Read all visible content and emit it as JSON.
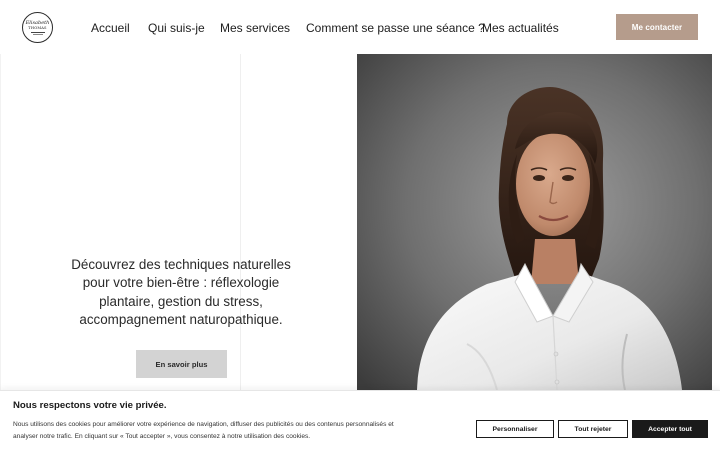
{
  "brand": {
    "logo_script": "Elisabeth",
    "logo_name": "THOMAS"
  },
  "nav": {
    "items": [
      {
        "label": "Accueil"
      },
      {
        "label": "Qui suis-je"
      },
      {
        "label": "Mes services"
      },
      {
        "label": "Comment se passe une séance ?"
      },
      {
        "label": "Mes actualités"
      }
    ],
    "contact_label": "Me contacter"
  },
  "hero": {
    "lines": [
      "Découvrez des techniques naturelles",
      "pour votre bien-être : réflexologie",
      "plantaire, gestion du stress,",
      "accompagnement naturopathique."
    ],
    "cta_label": "En savoir plus",
    "photo_icon": "portrait-photo"
  },
  "cookie": {
    "title": "Nous respectons votre vie privée.",
    "line1": "Nous utilisons des cookies pour améliorer votre expérience de navigation, diffuser des publicités ou des contenus personnalisés et",
    "line2": "analyser notre trafic. En cliquant sur « Tout accepter », vous consentez à notre utilisation des cookies.",
    "customize_label": "Personnaliser",
    "reject_label": "Tout rejeter",
    "accept_label": "Accepter tout"
  },
  "colors": {
    "accent": "#b59c8c",
    "button_grey": "#d3d3d3",
    "dark": "#1a1a1a"
  }
}
